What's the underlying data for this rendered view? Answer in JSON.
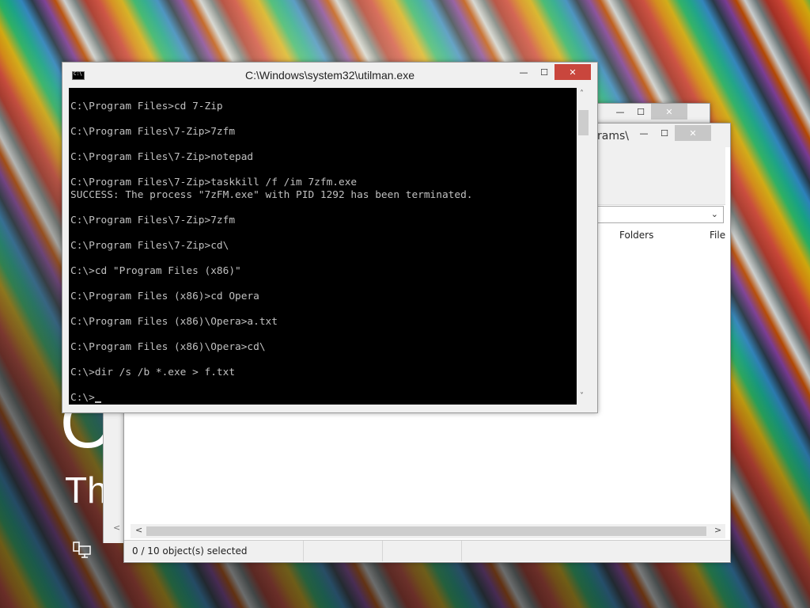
{
  "desktop": {
    "lock_big_text": "O",
    "lock_sub_text": "Th",
    "network_icon": "network-icon"
  },
  "back_window": {
    "minimize": "—",
    "maximize": "☐",
    "close": "✕"
  },
  "file_manager": {
    "title_partial": "rams\\",
    "minimize": "—",
    "maximize": "☐",
    "close": "✕",
    "address_chevron": "⌄",
    "columns": [
      "Folders",
      "File"
    ],
    "status_text": "0 / 10 object(s) selected",
    "scroll_left": "<",
    "scroll_right": ">",
    "left_arrow": "<"
  },
  "cmd": {
    "title": "C:\\Windows\\system32\\utilman.exe",
    "minimize": "—",
    "maximize": "☐",
    "close": "✕",
    "lines": [
      "C:\\Program Files>cd 7-Zip",
      "",
      "C:\\Program Files\\7-Zip>7zfm",
      "",
      "C:\\Program Files\\7-Zip>notepad",
      "",
      "C:\\Program Files\\7-Zip>taskkill /f /im 7zfm.exe",
      "SUCCESS: The process \"7zFM.exe\" with PID 1292 has been terminated.",
      "",
      "C:\\Program Files\\7-Zip>7zfm",
      "",
      "C:\\Program Files\\7-Zip>cd\\",
      "",
      "C:\\>cd \"Program Files (x86)\"",
      "",
      "C:\\Program Files (x86)>cd Opera",
      "",
      "C:\\Program Files (x86)\\Opera>a.txt",
      "",
      "C:\\Program Files (x86)\\Opera>cd\\",
      "",
      "C:\\>dir /s /b *.exe > f.txt",
      "",
      "C:\\>"
    ],
    "scroll_up": "˄",
    "scroll_down": "˅"
  }
}
